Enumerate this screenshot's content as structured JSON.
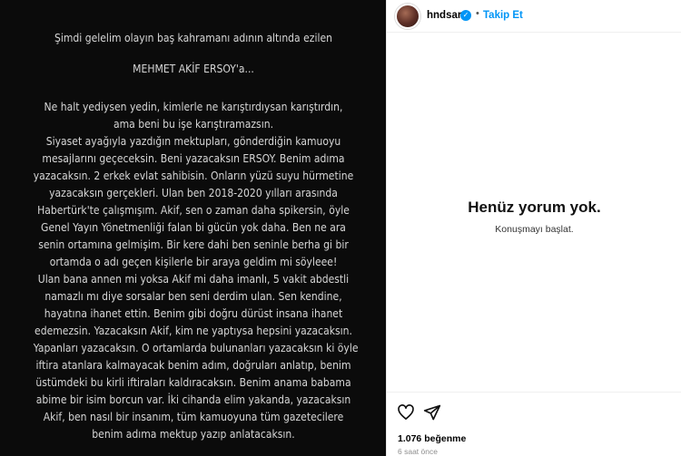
{
  "story": {
    "lines": [
      "Şimdi gelelim olayın baş kahramanı adının altında ezilen",
      "MEHMET AKİF ERSOY'a...",
      "Ne halt yediysen yedin, kimlerle ne karıştırdıysan karıştırdın,",
      "ama beni bu işe karıştıramazsın.",
      "Siyaset ayağıyla yazdığın mektupları, gönderdiğin kamuoyu",
      "mesajlarını geçeceksin. Beni yazacaksın ERSOY.  Benim adıma",
      "yazacaksın. 2 erkek evlat sahibisin. Onların yüzü suyu hürmetine",
      "yazacaksın gerçekleri. Ulan ben 2018-2020 yılları arasında",
      "Habertürk'te çalışmışım. Akif, sen o zaman daha spikersin, öyle",
      "Genel Yayın Yönetmenliği falan bi gücün yok daha.  Ben ne ara",
      "senin ortamına gelmişim. Bir kere dahi ben seninle berha gi bir",
      "ortamda o adı geçen kişilerle bir araya geldim mi söyleee!",
      "Ulan bana annen mi yoksa Akif mi daha imanlı, 5 vakit abdestli",
      "namazlı mı diye sorsalar ben seni derdim ulan. Sen kendine,",
      "hayatına ihanet ettin. Benim gibi doğru dürüst insana ihanet",
      "edemezsin. Yazacaksın Akif, kim ne yaptıysa hepsini yazacaksın.",
      "Yapanları yazacaksın. O ortamlarda bulunanları yazacaksın ki öyle",
      "iftira atanlara kalmayacak benim adım, doğruları anlatıp, benim",
      "üstümdeki bu kirli iftiraları kaldıracaksın. Benim anama babama",
      "abime bir isim borcun var. İki cihanda elim yakanda, yazacaksın",
      "Akif, ben nasıl bir insanım, tüm kamuoyuna tüm gazetecilere",
      "benim adıma mektup yazıp anlatacaksın."
    ]
  },
  "header": {
    "username": "hndsar",
    "separator": "•",
    "follow_label": "Takip Et"
  },
  "comments": {
    "empty_title": "Henüz yorum yok.",
    "empty_subtitle": "Konuşmayı başlat."
  },
  "actions": {
    "likes": "1.076 beğenme",
    "time": "6 saat önce"
  },
  "icons": {
    "verified": "verified-badge-icon",
    "like": "heart-icon",
    "share": "paper-plane-icon"
  },
  "colors": {
    "story_bg": "#0b0b0b",
    "story_text": "#d6d6d6",
    "accent": "#0095f6"
  }
}
